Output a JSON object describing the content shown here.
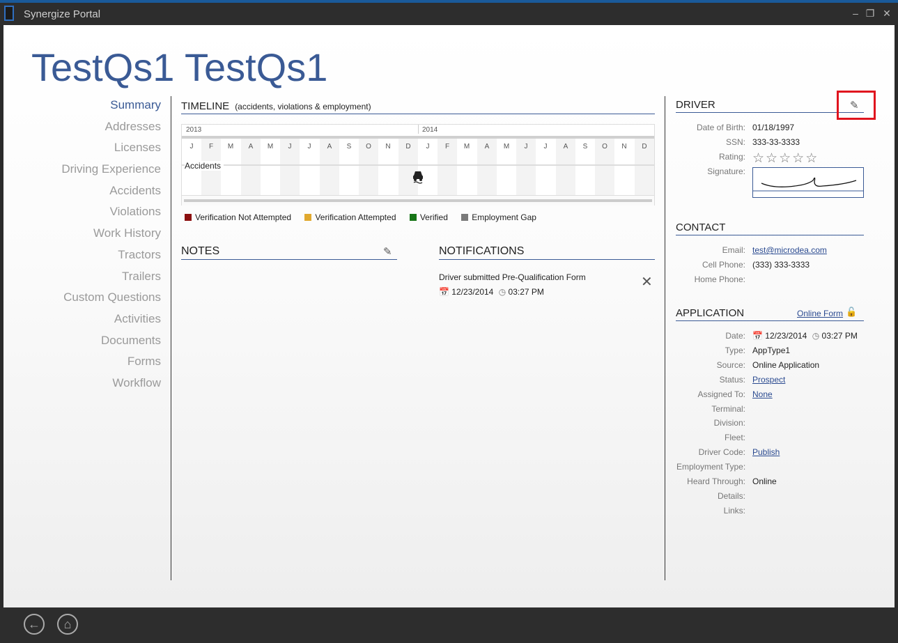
{
  "window": {
    "title": "Synergize Portal"
  },
  "page": {
    "title": "TestQs1 TestQs1"
  },
  "nav": {
    "items": [
      "Summary",
      "Addresses",
      "Licenses",
      "Driving Experience",
      "Accidents",
      "Violations",
      "Work History",
      "Tractors",
      "Trailers",
      "Custom Questions",
      "Activities",
      "Documents",
      "Forms",
      "Workflow"
    ],
    "active": "Summary"
  },
  "timeline": {
    "title": "TIMELINE",
    "subtitle": "(accidents, violations & employment)",
    "years": [
      "2013",
      "2014"
    ],
    "months": [
      "J",
      "F",
      "M",
      "A",
      "M",
      "J",
      "J",
      "A",
      "S",
      "O",
      "N",
      "D",
      "J",
      "F",
      "M",
      "A",
      "M",
      "J",
      "J",
      "A",
      "S",
      "O",
      "N",
      "D"
    ],
    "row_label": "Accidents"
  },
  "legend": [
    {
      "label": "Verification Not Attempted",
      "color": "#8b1010"
    },
    {
      "label": "Verification Attempted",
      "color": "#e0a82e"
    },
    {
      "label": "Verified",
      "color": "#177517"
    },
    {
      "label": "Employment Gap",
      "color": "#7a7a7a"
    }
  ],
  "notes": {
    "title": "NOTES"
  },
  "notifications": {
    "title": "NOTIFICATIONS",
    "items": [
      {
        "text": "Driver submitted Pre-Qualification Form",
        "date": "12/23/2014",
        "time": "03:27 PM"
      }
    ]
  },
  "driver": {
    "title": "DRIVER",
    "dob_label": "Date of Birth:",
    "dob": "01/18/1997",
    "ssn_label": "SSN:",
    "ssn": "333-33-3333",
    "rating_label": "Rating:",
    "rating": 0,
    "signature_label": "Signature:"
  },
  "contact": {
    "title": "CONTACT",
    "email_label": "Email:",
    "email": "test@microdea.com",
    "cell_label": "Cell Phone:",
    "cell": "(333) 333-3333",
    "home_label": "Home Phone:",
    "home": ""
  },
  "application": {
    "title": "APPLICATION",
    "online_form": "Online Form",
    "date_label": "Date:",
    "date": "12/23/2014",
    "time": "03:27 PM",
    "type_label": "Type:",
    "type": "AppType1",
    "source_label": "Source:",
    "source": "Online Application",
    "status_label": "Status:",
    "status": "Prospect",
    "assigned_label": "Assigned To:",
    "assigned": "None",
    "terminal_label": "Terminal:",
    "terminal": "",
    "division_label": "Division:",
    "division": "",
    "fleet_label": "Fleet:",
    "fleet": "",
    "driver_code_label": "Driver Code:",
    "driver_code": "Publish",
    "emp_type_label": "Employment Type:",
    "emp_type": "",
    "heard_label": "Heard Through:",
    "heard": "Online",
    "details_label": "Details:",
    "details": "",
    "links_label": "Links:",
    "links": ""
  },
  "colors": {
    "accent": "#3a5a95",
    "highlight": "#e0141e",
    "chrome": "#2d2d2d"
  }
}
